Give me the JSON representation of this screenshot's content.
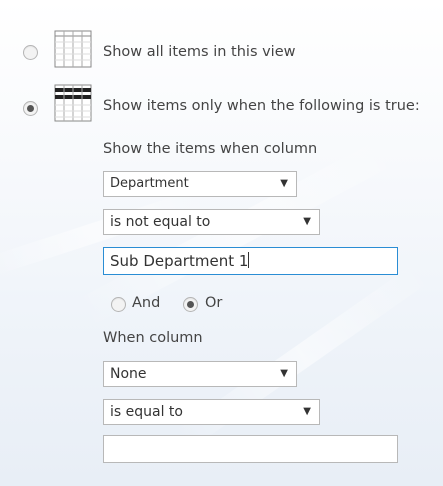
{
  "view_options": {
    "all_items_label": "Show all items in this view",
    "filtered_label": "Show items only when the following is true:"
  },
  "filter": {
    "column_prompt": "Show the items when column",
    "column1": {
      "value": "Department"
    },
    "operator1": {
      "value": "is not equal to"
    },
    "value1": "Sub Department 1",
    "logic": {
      "and_label": "And",
      "or_label": "Or"
    },
    "column2_prompt": "When column",
    "column2": {
      "value": "None"
    },
    "operator2": {
      "value": "is equal to"
    },
    "value2": ""
  },
  "icons": {
    "dropdown": "caret-down-icon",
    "list": "table-grid-icon",
    "filtered_list": "filtered-table-icon"
  },
  "colors": {
    "focus_border": "#2a8dd4"
  }
}
